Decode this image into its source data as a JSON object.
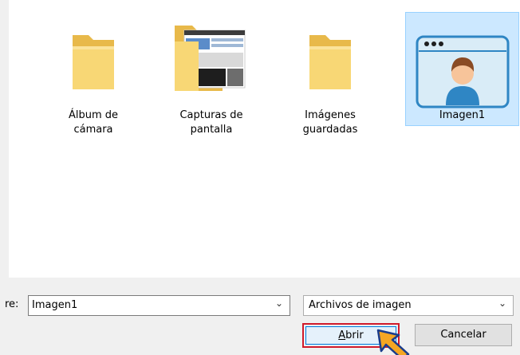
{
  "folders": [
    {
      "line1": "Álbum de",
      "line2": "cámara",
      "icon": "folder-icon"
    },
    {
      "line1": "Capturas de",
      "line2": "pantalla",
      "icon": "folder-screenshots-icon"
    },
    {
      "line1": "Imágenes",
      "line2": "guardadas",
      "icon": "folder-icon"
    }
  ],
  "image_file": {
    "label": "Imagen1",
    "icon": "image-file-icon",
    "selected": true
  },
  "footer": {
    "name_label": "re:",
    "name_value": "Imagen1",
    "type_value": "Archivos de imagen",
    "open_label_access": "A",
    "open_label_rest": "brir",
    "cancel_label": "Cancelar"
  },
  "colors": {
    "selection_bg": "#cce8ff",
    "folder_yellow": "#f8d775",
    "highlight_red": "#d11b2a",
    "accent_blue": "#0078d7",
    "pointer_orange": "#f5a623"
  }
}
